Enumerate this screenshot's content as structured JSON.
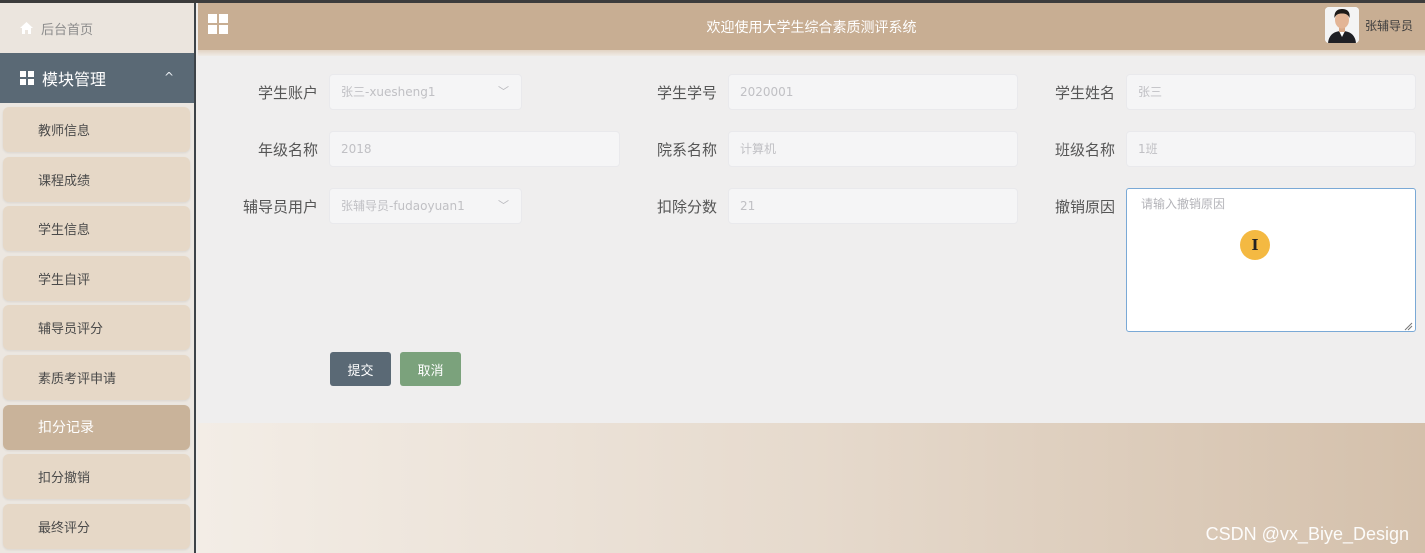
{
  "header": {
    "title": "欢迎使用大学生综合素质测评系统",
    "username": "张辅导员"
  },
  "sidebar": {
    "home_label": "后台首页",
    "module_label": "模块管理",
    "items": [
      {
        "label": "教师信息"
      },
      {
        "label": "课程成绩"
      },
      {
        "label": "学生信息"
      },
      {
        "label": "学生自评"
      },
      {
        "label": "辅导员评分"
      },
      {
        "label": "素质考评申请"
      },
      {
        "label": "扣分记录",
        "active": true
      },
      {
        "label": "扣分撤销"
      },
      {
        "label": "最终评分"
      }
    ]
  },
  "form": {
    "student_account": {
      "label": "学生账户",
      "value": "张三-xuesheng1"
    },
    "student_no": {
      "label": "学生学号",
      "value": "2020001"
    },
    "student_name": {
      "label": "学生姓名",
      "value": "张三"
    },
    "grade_name": {
      "label": "年级名称",
      "value": "2018"
    },
    "department_name": {
      "label": "院系名称",
      "value": "计算机"
    },
    "class_name": {
      "label": "班级名称",
      "value": "1班"
    },
    "counselor_user": {
      "label": "辅导员用户",
      "value": "张辅导员-fudaoyuan1"
    },
    "deducted_points": {
      "label": "扣除分数",
      "value": "21"
    },
    "revoke_reason": {
      "label": "撤销原因",
      "placeholder": "请输入撤销原因"
    }
  },
  "buttons": {
    "submit": "提交",
    "cancel": "取消"
  },
  "watermark": "CSDN @vx_Biye_Design",
  "colors": {
    "header": "#c8ae93",
    "module_header": "#5a6975",
    "menu_item": "#e6d8c7",
    "menu_active": "#c9b39a",
    "submit_button": "#5a6975",
    "cancel_button": "#7ba27c",
    "textarea_focus_border": "#7aa9d6"
  },
  "icons": {
    "home": "home-icon",
    "module": "grid-icon",
    "collapse": "chevron-up-icon",
    "app_menu": "apps-icon",
    "select_arrow": "chevron-down-icon",
    "text_cursor": "text-cursor-icon"
  }
}
